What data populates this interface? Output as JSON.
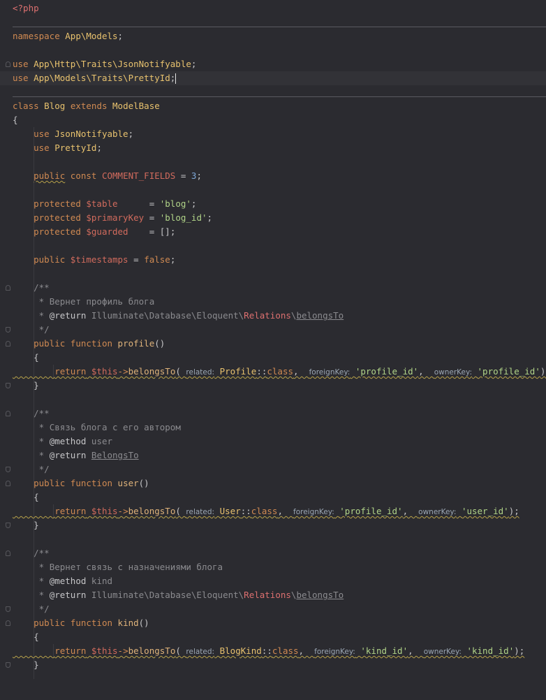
{
  "app": {
    "kind": "code-editor",
    "language": "PHP"
  },
  "code": {
    "php_open": "<?php",
    "namespace_kw": "namespace",
    "namespace_path": "App\\Models",
    "semicolon": ";",
    "use_kw": "use",
    "use1_path": "App\\Http\\Traits\\JsonNotifyable",
    "use2_path": "App\\Models\\Traits\\PrettyId",
    "class_kw": "class",
    "class_name": "Blog",
    "extends_kw": "extends",
    "base_class": "ModelBase",
    "brace_open": "{",
    "brace_close": "}",
    "trait1": "JsonNotifyable",
    "trait2": "PrettyId",
    "public_kw": "public",
    "const_kw": "const",
    "const_name": "COMMENT_FIELDS",
    "const_value": "3",
    "protected_kw": "protected",
    "prop_table": "$table",
    "prop_table_value": "'blog'",
    "prop_pk": "$primaryKey",
    "prop_pk_value": "'blog_id'",
    "prop_guarded": "$guarded",
    "prop_guarded_value": "[]",
    "prop_timestamps": "$timestamps",
    "prop_timestamps_value": "false",
    "function_kw": "function",
    "return_kw": "return",
    "this_var": "$this",
    "arrow": "->",
    "belongs_to": "belongsTo",
    "class_const": "class",
    "hint_related": "related:",
    "hint_foreign": "foreignKey:",
    "hint_owner": "ownerKey:",
    "doc_open": "/**",
    "doc_close": "*/",
    "doc_star": "*",
    "tag_return": "@return",
    "tag_method": "@method",
    "ns_illuminate": "Illuminate\\Database\\Eloquent\\",
    "ns_relations": "Relations",
    "ns_belongs_to": "belongsTo",
    "belongs_to_class": "BelongsTo",
    "methods": [
      {
        "name": "profile",
        "doc": "Вернет профиль блога",
        "related": "Profile",
        "foreign": "'profile_id'",
        "owner": "'profile_id'"
      },
      {
        "name": "user",
        "doc": "Связь блога с его автором",
        "method_tag_value": "user",
        "related": "User",
        "foreign": "'profile_id'",
        "owner": "'user_id'"
      },
      {
        "name": "kind",
        "doc": "Вернет связь с назначениями блога",
        "method_tag_value": "kind",
        "related": "BlogKind",
        "foreign": "'kind_id'",
        "owner": "'kind_id'"
      }
    ]
  },
  "colors": {
    "background": "#2b2b30",
    "current_line": "#323237",
    "keyword": "#d08a52",
    "class_name": "#e8c26e",
    "variable": "#d16b5d",
    "string": "#b1d488",
    "number": "#7ea8d8",
    "comment": "#8b8b8f"
  }
}
